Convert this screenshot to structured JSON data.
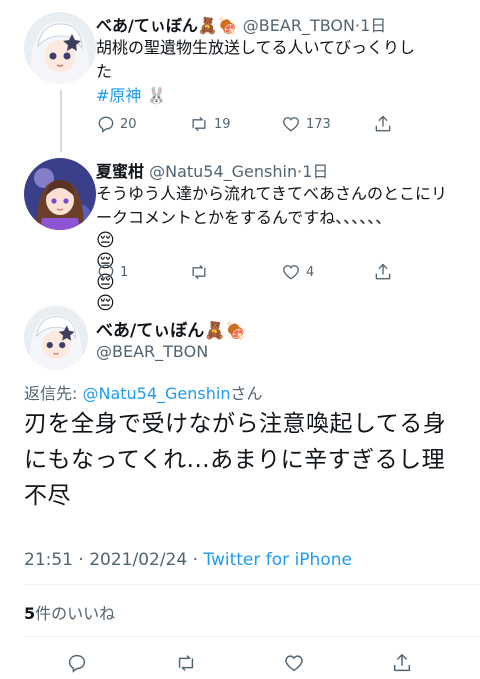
{
  "tweet1": {
    "name": "べあ/てぃぼん",
    "name_emoji": "🧸🍖",
    "handle": "@BEAR_TBON",
    "time": "1日",
    "text": "胡桃の聖遺物生放送してる人いてびっくりした",
    "hashtag": "#原神",
    "replies": "20",
    "retweets": "19",
    "likes": "173"
  },
  "tweet2": {
    "name": "夏蜜柑",
    "handle": "@Natu54_Genshin",
    "time": "1日",
    "text": "そうゆう人達から流れてきてべあさんのとこにリークコメントとかをするんですね、、、、、、",
    "emojis": "😔😔😔😔",
    "replies": "1",
    "retweets": "",
    "likes": "4"
  },
  "main": {
    "name": "べあ/てぃぼん",
    "name_emoji": "🧸🍖",
    "handle": "@BEAR_TBON",
    "reply_prefix": "返信先: ",
    "reply_target": "@Natu54_Genshin",
    "reply_suffix": "さん",
    "text": "刃を全身で受けながら注意喚起してる身にもなってくれ...あまりに辛すぎるし理不尽",
    "timestamp": "21:51 · 2021/02/24 · ",
    "client": "Twitter for iPhone",
    "likes_count": "5",
    "likes_label": "件のいいね"
  },
  "colors": {
    "accent": "#1d9bf0",
    "secondary_text": "#536471",
    "thread_line": "#cfd9de"
  },
  "icons": [
    "reply-icon",
    "retweet-icon",
    "like-icon",
    "share-icon"
  ]
}
